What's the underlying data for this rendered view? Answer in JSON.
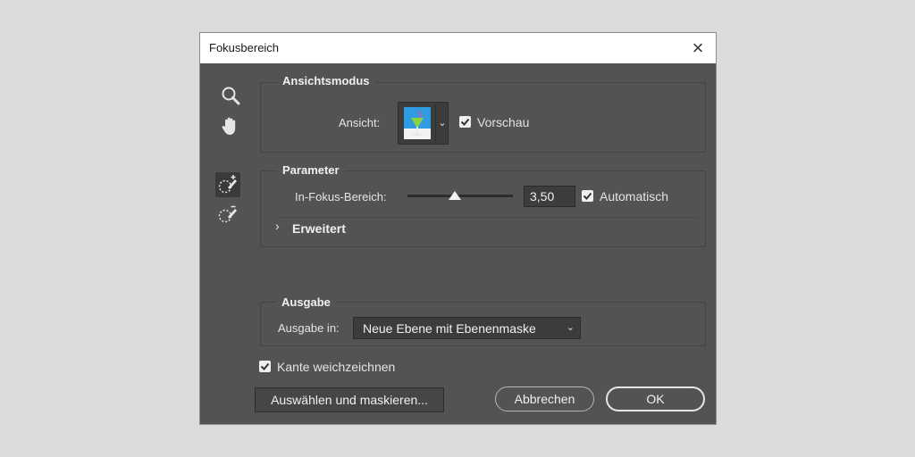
{
  "window": {
    "title": "Fokusbereich",
    "close_icon": "×"
  },
  "tools": [
    {
      "name": "zoom-tool",
      "icon": "magnifier-icon"
    },
    {
      "name": "hand-tool",
      "icon": "hand-icon"
    },
    {
      "name": "focus-area-add-tool",
      "icon": "focus-add-brush-icon",
      "active": true
    },
    {
      "name": "focus-area-subtract-tool",
      "icon": "focus-subtract-brush-icon"
    }
  ],
  "view_mode": {
    "group_label": "Ansichtsmodus",
    "view_label": "Ansicht:",
    "preview_label": "Vorschau",
    "preview_checked": true
  },
  "parameters": {
    "group_label": "Parameter",
    "range_label": "In-Fokus-Bereich:",
    "range_value": "3,50",
    "slider_fraction": 0.45,
    "auto_label": "Automatisch",
    "auto_checked": true,
    "advanced_label": "Erweitert"
  },
  "output": {
    "group_label": "Ausgabe",
    "output_label": "Ausgabe in:",
    "output_value": "Neue Ebene mit Ebenenmaske"
  },
  "soften_edge": {
    "label": "Kante weichzeichnen",
    "checked": true
  },
  "buttons": {
    "select_mask": "Auswählen und maskieren...",
    "cancel": "Abbrechen",
    "ok": "OK"
  },
  "colors": {
    "dialog_bg": "#535353",
    "page_bg": "#dcdcdc"
  }
}
